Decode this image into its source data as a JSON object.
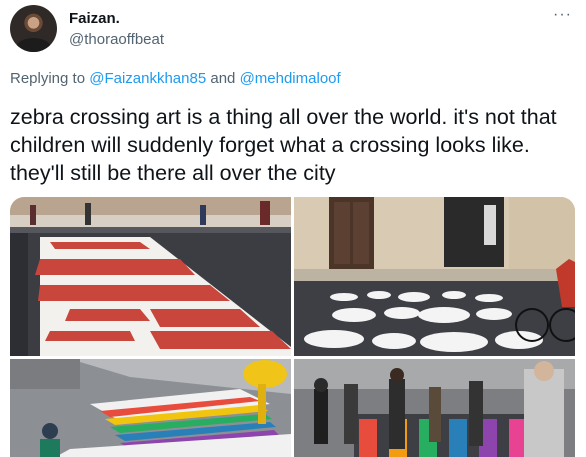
{
  "author": {
    "name": "Faizan.",
    "handle": "@thoraoffbeat"
  },
  "menu": {
    "more_icon": "more-horizontal-icon",
    "glyph": "···"
  },
  "reply": {
    "prefix": "Replying to ",
    "mentions": [
      "@Faizankkhan85",
      "@mehdimaloof"
    ],
    "joiner": " and "
  },
  "tweet": {
    "text": "zebra crossing art is a thing all over the world. it's not that children will suddenly forget what a crossing looks like. they'll still be there all over the city"
  },
  "colors": {
    "text": "#0f1419",
    "secondary": "#536471",
    "link": "#1d9bf0"
  },
  "media": {
    "count": 4,
    "photos": [
      "red-white-crossing-photo",
      "white-dots-crossing-photo",
      "rainbow-crossing-photo",
      "colorful-crossing-pedestrians-photo"
    ]
  }
}
